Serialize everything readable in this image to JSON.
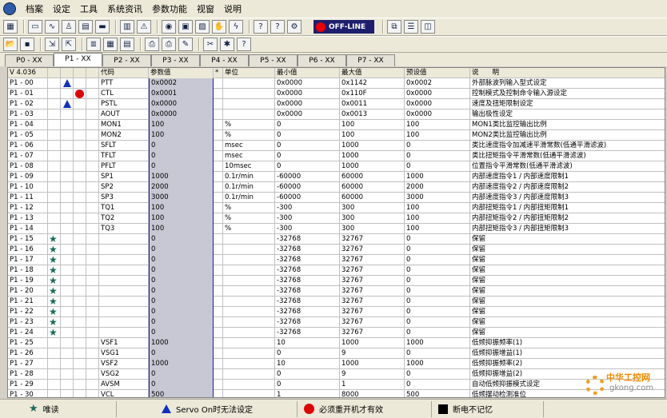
{
  "menu": [
    "档案",
    "设定",
    "工具",
    "系统资讯",
    "参数功能",
    "视窗",
    "说明"
  ],
  "toolbar1_icons": [
    "layout-icon",
    "monitor-icon",
    "scope-icon",
    "person-icon",
    "terminal-icon",
    "disk-icon",
    "panel-icon",
    "warning-icon",
    "circle-icon",
    "capture-icon",
    "chart-icon",
    "hand-icon",
    "flash-icon",
    "help-icon",
    "help2-icon",
    "wrench-icon"
  ],
  "offline_label": "OFF-LINE",
  "toolbar2_icons": [
    "open-icon",
    "save-icon",
    "import-icon",
    "export-icon",
    "param-icon",
    "grid-icon",
    "table-icon",
    "print-icon",
    "printer2-icon",
    "edit-icon",
    "tools-icon",
    "bug-icon",
    "help-icon"
  ],
  "tabs": [
    "P0 - XX",
    "P1 - XX",
    "P2 - XX",
    "P3 - XX",
    "P4 - XX",
    "P5 - XX",
    "P6 - XX",
    "P7 - XX"
  ],
  "active_tab": 1,
  "header": {
    "version": "V 4.036",
    "code": "代码",
    "value": "参数值",
    "star": "*",
    "unit": "单位",
    "min": "最小值",
    "max": "最大值",
    "def": "预设值",
    "desc": "说　　明"
  },
  "rows": [
    {
      "no": "P1 - 00",
      "f2": "tri",
      "code": "PTT",
      "val": "0x0002",
      "unit": "",
      "min": "0x0000",
      "max": "0x1142",
      "def": "0x0002",
      "desc": "外部脉波列输入型式设定"
    },
    {
      "no": "P1 - 01",
      "f3": "circ",
      "code": "CTL",
      "val": "0x0001",
      "unit": "",
      "min": "0x0000",
      "max": "0x110F",
      "def": "0x0000",
      "desc": "控制模式及控制命令输入源设定"
    },
    {
      "no": "P1 - 02",
      "f2": "tri",
      "code": "PSTL",
      "val": "0x0000",
      "unit": "",
      "min": "0x0000",
      "max": "0x0011",
      "def": "0x0000",
      "desc": "速度及扭矩限制设定"
    },
    {
      "no": "P1 - 03",
      "code": "AOUT",
      "val": "0x0000",
      "unit": "",
      "min": "0x0000",
      "max": "0x0013",
      "def": "0x0000",
      "desc": "输出极性设定"
    },
    {
      "no": "P1 - 04",
      "code": "MON1",
      "val": "100",
      "unit": "%",
      "min": "0",
      "max": "100",
      "def": "100",
      "desc": "MON1类比监控输出比例"
    },
    {
      "no": "P1 - 05",
      "code": "MON2",
      "val": "100",
      "unit": "%",
      "min": "0",
      "max": "100",
      "def": "100",
      "desc": "MON2类比监控输出比例"
    },
    {
      "no": "P1 - 06",
      "code": "SFLT",
      "val": "0",
      "unit": "msec",
      "min": "0",
      "max": "1000",
      "def": "0",
      "desc": "类比速度指令加减速平滑常数(低通平滑滤波)"
    },
    {
      "no": "P1 - 07",
      "code": "TFLT",
      "val": "0",
      "unit": "msec",
      "min": "0",
      "max": "1000",
      "def": "0",
      "desc": "类比扭矩指令平滑常数(低通平滑滤波)"
    },
    {
      "no": "P1 - 08",
      "code": "PFLT",
      "val": "0",
      "unit": "10msec",
      "min": "0",
      "max": "1000",
      "def": "0",
      "desc": "位置指令平滑常数(低通平滑滤波)"
    },
    {
      "no": "P1 - 09",
      "code": "SP1",
      "val": "1000",
      "unit": "0.1r/min",
      "min": "-60000",
      "max": "60000",
      "def": "1000",
      "desc": "内部速度指令1 / 内部速度限制1"
    },
    {
      "no": "P1 - 10",
      "code": "SP2",
      "val": "2000",
      "unit": "0.1r/min",
      "min": "-60000",
      "max": "60000",
      "def": "2000",
      "desc": "内部速度指令2 / 内部速度限制2"
    },
    {
      "no": "P1 - 11",
      "code": "SP3",
      "val": "3000",
      "unit": "0.1r/min",
      "min": "-60000",
      "max": "60000",
      "def": "3000",
      "desc": "内部速度指令3 / 内部速度限制3"
    },
    {
      "no": "P1 - 12",
      "code": "TQ1",
      "val": "100",
      "unit": "%",
      "min": "-300",
      "max": "300",
      "def": "100",
      "desc": "内部扭矩指令1 / 内部扭矩限制1"
    },
    {
      "no": "P1 - 13",
      "code": "TQ2",
      "val": "100",
      "unit": "%",
      "min": "-300",
      "max": "300",
      "def": "100",
      "desc": "内部扭矩指令2 / 内部扭矩限制2"
    },
    {
      "no": "P1 - 14",
      "code": "TQ3",
      "val": "100",
      "unit": "%",
      "min": "-300",
      "max": "300",
      "def": "100",
      "desc": "内部扭矩指令3 / 内部扭矩限制3"
    },
    {
      "no": "P1 - 15",
      "f1": "star",
      "code": "",
      "val": "0",
      "unit": "",
      "min": "-32768",
      "max": "32767",
      "def": "0",
      "desc": "保留"
    },
    {
      "no": "P1 - 16",
      "f1": "star",
      "code": "",
      "val": "0",
      "unit": "",
      "min": "-32768",
      "max": "32767",
      "def": "0",
      "desc": "保留"
    },
    {
      "no": "P1 - 17",
      "f1": "star",
      "code": "",
      "val": "0",
      "unit": "",
      "min": "-32768",
      "max": "32767",
      "def": "0",
      "desc": "保留"
    },
    {
      "no": "P1 - 18",
      "f1": "star",
      "code": "",
      "val": "0",
      "unit": "",
      "min": "-32768",
      "max": "32767",
      "def": "0",
      "desc": "保留"
    },
    {
      "no": "P1 - 19",
      "f1": "star",
      "code": "",
      "val": "0",
      "unit": "",
      "min": "-32768",
      "max": "32767",
      "def": "0",
      "desc": "保留"
    },
    {
      "no": "P1 - 20",
      "f1": "star",
      "code": "",
      "val": "0",
      "unit": "",
      "min": "-32768",
      "max": "32767",
      "def": "0",
      "desc": "保留"
    },
    {
      "no": "P1 - 21",
      "f1": "star",
      "code": "",
      "val": "0",
      "unit": "",
      "min": "-32768",
      "max": "32767",
      "def": "0",
      "desc": "保留"
    },
    {
      "no": "P1 - 22",
      "f1": "star",
      "code": "",
      "val": "0",
      "unit": "",
      "min": "-32768",
      "max": "32767",
      "def": "0",
      "desc": "保留"
    },
    {
      "no": "P1 - 23",
      "f1": "star",
      "code": "",
      "val": "0",
      "unit": "",
      "min": "-32768",
      "max": "32767",
      "def": "0",
      "desc": "保留"
    },
    {
      "no": "P1 - 24",
      "f1": "star",
      "code": "",
      "val": "0",
      "unit": "",
      "min": "-32768",
      "max": "32767",
      "def": "0",
      "desc": "保留"
    },
    {
      "no": "P1 - 25",
      "code": "VSF1",
      "val": "1000",
      "unit": "",
      "min": "10",
      "max": "1000",
      "def": "1000",
      "desc": "低频抑振频率(1)"
    },
    {
      "no": "P1 - 26",
      "code": "VSG1",
      "val": "0",
      "unit": "",
      "min": "0",
      "max": "9",
      "def": "0",
      "desc": "低频抑振增益(1)"
    },
    {
      "no": "P1 - 27",
      "code": "VSF2",
      "val": "1000",
      "unit": "",
      "min": "10",
      "max": "1000",
      "def": "1000",
      "desc": "低频抑振频率(2)"
    },
    {
      "no": "P1 - 28",
      "code": "VSG2",
      "val": "0",
      "unit": "",
      "min": "0",
      "max": "9",
      "def": "0",
      "desc": "低频抑振增益(2)"
    },
    {
      "no": "P1 - 29",
      "code": "AVSM",
      "val": "0",
      "unit": "",
      "min": "0",
      "max": "1",
      "def": "0",
      "desc": "自动低频抑振模式设定"
    },
    {
      "no": "P1 - 30",
      "code": "VCL",
      "val": "500",
      "unit": "",
      "min": "1",
      "max": "8000",
      "def": "500",
      "desc": "低频摆动检测准位"
    }
  ],
  "legend": {
    "star": "唯读",
    "tri": "Servo On时无法设定",
    "circ": "必须重开机才有效",
    "sq": "断电不记忆"
  },
  "watermark": {
    "t1": "中华工控网",
    "t2": "gkong.com"
  }
}
